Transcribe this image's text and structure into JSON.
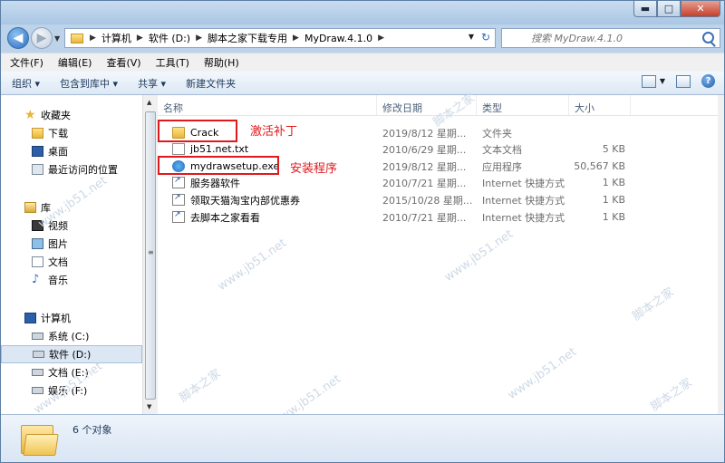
{
  "window": {
    "controls": {
      "minimize": "▬",
      "maximize": "□",
      "close": "✕"
    }
  },
  "address": {
    "crumbs": [
      "计算机",
      "软件 (D:)",
      "脚本之家下载专用",
      "MyDraw.4.1.0"
    ],
    "search_placeholder": "搜索 MyDraw.4.1.0"
  },
  "menu": {
    "items": [
      "文件(F)",
      "编辑(E)",
      "查看(V)",
      "工具(T)",
      "帮助(H)"
    ]
  },
  "toolbar": {
    "organize": "组织 ▾",
    "include": "包含到库中 ▾",
    "share": "共享 ▾",
    "new_folder": "新建文件夹"
  },
  "nav": {
    "favorites": {
      "label": "收藏夹",
      "items": [
        "下载",
        "桌面",
        "最近访问的位置"
      ]
    },
    "libraries": {
      "label": "库",
      "items": [
        "视频",
        "图片",
        "文档",
        "音乐"
      ]
    },
    "computer": {
      "label": "计算机",
      "items": [
        "系统 (C:)",
        "软件 (D:)",
        "文档 (E:)",
        "娱乐 (F:)"
      ]
    }
  },
  "columns": {
    "name": "名称",
    "date": "修改日期",
    "type": "类型",
    "size": "大小"
  },
  "files": [
    {
      "name": "Crack",
      "date": "2019/8/12 星期...",
      "type": "文件夹",
      "size": "",
      "icon": "folder-icon"
    },
    {
      "name": "jb51.net.txt",
      "date": "2010/6/29 星期...",
      "type": "文本文档",
      "size": "5 KB",
      "icon": "text-file-icon"
    },
    {
      "name": "mydrawsetup.exe",
      "date": "2019/8/12 星期...",
      "type": "应用程序",
      "size": "50,567 KB",
      "icon": "setup-exe-icon"
    },
    {
      "name": "服务器软件",
      "date": "2010/7/21 星期...",
      "type": "Internet 快捷方式",
      "size": "1 KB",
      "icon": "shortcut-icon"
    },
    {
      "name": "领取天猫淘宝内部优惠券",
      "date": "2015/10/28 星期...",
      "type": "Internet 快捷方式",
      "size": "1 KB",
      "icon": "shortcut-icon"
    },
    {
      "name": "去脚本之家看看",
      "date": "2010/7/21 星期...",
      "type": "Internet 快捷方式",
      "size": "1 KB",
      "icon": "shortcut-icon"
    }
  ],
  "annotations": {
    "crack": "激活补丁",
    "setup": "安装程序"
  },
  "status": {
    "count": "6 个对象"
  },
  "watermarks": [
    "www.jb51.net",
    "脚本之家"
  ],
  "colors": {
    "annotation": "#e0191c",
    "selection": "#dce7f4",
    "chrome": "#bcd3ea"
  }
}
